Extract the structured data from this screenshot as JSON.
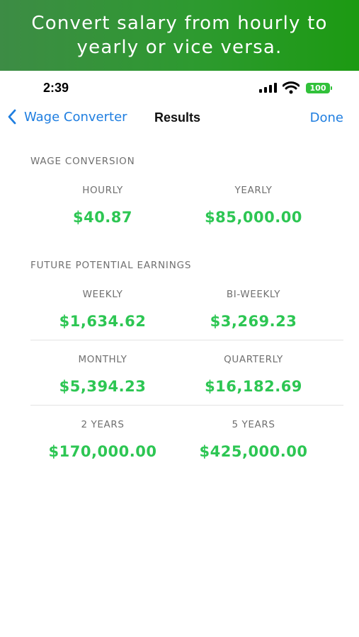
{
  "banner": {
    "text": "Convert salary from hourly to yearly or vice versa."
  },
  "status_bar": {
    "time": "2:39",
    "battery": "100"
  },
  "nav": {
    "back_label": "Wage Converter",
    "title": "Results",
    "done_label": "Done"
  },
  "colors": {
    "accent": "#1f7ee0",
    "value_green": "#2dc653",
    "banner_green": "#1c9a12"
  },
  "wage_conversion": {
    "header": "WAGE CONVERSION",
    "items": [
      {
        "label": "HOURLY",
        "value": "$40.87"
      },
      {
        "label": "YEARLY",
        "value": "$85,000.00"
      }
    ]
  },
  "future_earnings": {
    "header": "FUTURE POTENTIAL EARNINGS",
    "items": [
      {
        "label": "WEEKLY",
        "value": "$1,634.62"
      },
      {
        "label": "BI-WEEKLY",
        "value": "$3,269.23"
      },
      {
        "label": "MONTHLY",
        "value": "$5,394.23"
      },
      {
        "label": "QUARTERLY",
        "value": "$16,182.69"
      },
      {
        "label": "2 YEARS",
        "value": "$170,000.00"
      },
      {
        "label": "5 YEARS",
        "value": "$425,000.00"
      }
    ]
  }
}
